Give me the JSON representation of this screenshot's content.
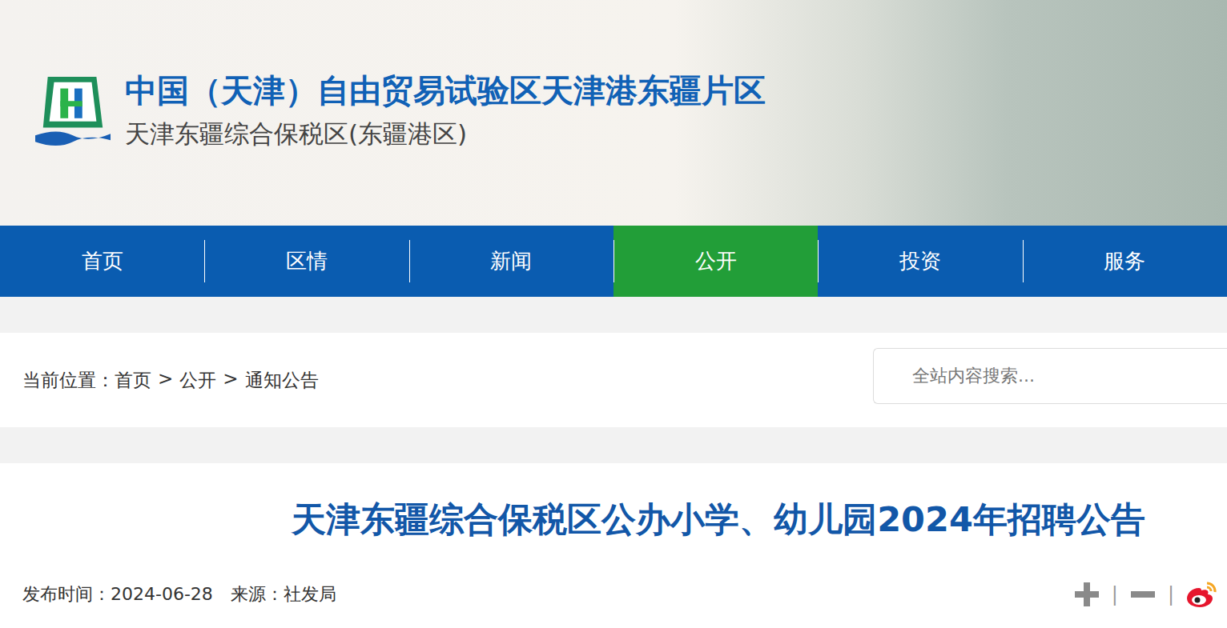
{
  "header": {
    "title": "中国（天津）自由贸易试验区天津港东疆片区",
    "subtitle": "天津东疆综合保税区(东疆港区)"
  },
  "nav": [
    {
      "label": "首页",
      "selected": false
    },
    {
      "label": "区情",
      "selected": false
    },
    {
      "label": "新闻",
      "selected": false
    },
    {
      "label": "公开",
      "selected": true
    },
    {
      "label": "投资",
      "selected": false
    },
    {
      "label": "服务",
      "selected": false
    }
  ],
  "breadcrumb": {
    "label": "当前位置：",
    "separator": ">",
    "items": [
      "首页",
      "公开",
      "通知公告"
    ]
  },
  "search": {
    "placeholder": "全站内容搜索..."
  },
  "article": {
    "title": "天津东疆综合保税区公办小学、幼儿园2024年招聘公告",
    "published_label": "发布时间：",
    "published": "2024-06-28",
    "source_label": "来源：",
    "source": "社发局"
  },
  "tools": {
    "separator": "|"
  }
}
